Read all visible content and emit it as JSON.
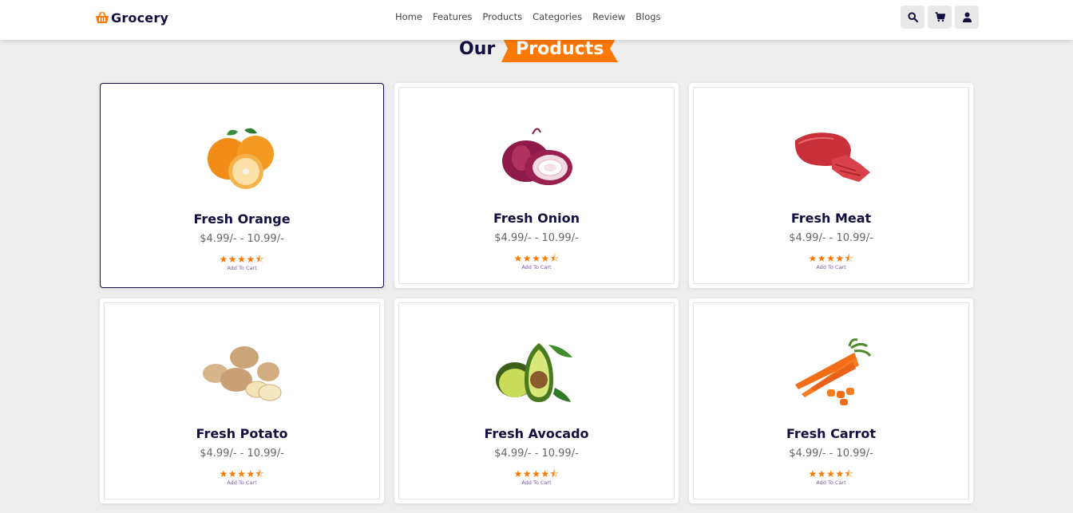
{
  "header": {
    "logo_text": "Grocery",
    "nav": [
      "Home",
      "Features",
      "Products",
      "Categories",
      "Review",
      "Blogs"
    ],
    "icons": [
      "search-icon",
      "cart-icon",
      "user-icon"
    ]
  },
  "section": {
    "title_plain": "Our",
    "title_highlight": "Products"
  },
  "colors": {
    "accent": "#ff7800",
    "dark": "#130f40",
    "background": "#eeeeee"
  },
  "products": [
    {
      "name": "Fresh Orange",
      "price": "$4.99/- - 10.99/-",
      "rating": "★★★★⯪",
      "cta": "Add To Cart",
      "image": "orange"
    },
    {
      "name": "Fresh Onion",
      "price": "$4.99/- - 10.99/-",
      "rating": "★★★★⯪",
      "cta": "Add To Cart",
      "image": "onion"
    },
    {
      "name": "Fresh Meat",
      "price": "$4.99/- - 10.99/-",
      "rating": "★★★★⯪",
      "cta": "Add To Cart",
      "image": "meat"
    },
    {
      "name": "Fresh Potato",
      "price": "$4.99/- - 10.99/-",
      "rating": "★★★★⯪",
      "cta": "Add To Cart",
      "image": "potato"
    },
    {
      "name": "Fresh Avocado",
      "price": "$4.99/- - 10.99/-",
      "rating": "★★★★⯪",
      "cta": "Add To Cart",
      "image": "avocado"
    },
    {
      "name": "Fresh Carrot",
      "price": "$4.99/- - 10.99/-",
      "rating": "★★★★⯪",
      "cta": "Add To Cart",
      "image": "carrot"
    }
  ]
}
